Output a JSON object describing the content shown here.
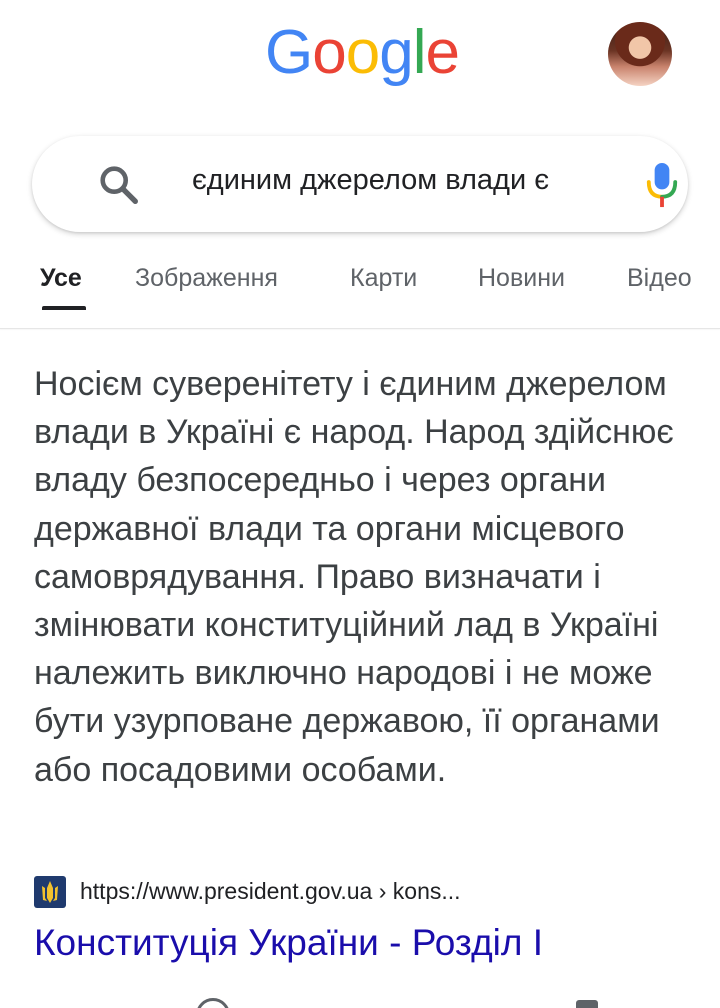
{
  "header": {
    "logo_letters": [
      {
        "char": "G",
        "color": "#4285F4"
      },
      {
        "char": "o",
        "color": "#EA4335"
      },
      {
        "char": "o",
        "color": "#FBBC05"
      },
      {
        "char": "g",
        "color": "#4285F4"
      },
      {
        "char": "l",
        "color": "#34A853"
      },
      {
        "char": "e",
        "color": "#EA4335"
      }
    ]
  },
  "search": {
    "query": "єдиним джерелом влади є"
  },
  "tabs": [
    {
      "label": "Усе",
      "active": true
    },
    {
      "label": "Зображення",
      "active": false
    },
    {
      "label": "Карти",
      "active": false
    },
    {
      "label": "Новини",
      "active": false
    },
    {
      "label": "Відео",
      "active": false
    }
  ],
  "snippet": {
    "text": "Носієм суверенітету і єдиним джерелом влади в Україні є народ. Народ здійснює владу безпосередньо і через органи державної влади та органи місцевого самоврядування. Право визначати і змінювати конституційний лад в Україні належить виключно народові і не може бути узурповане державою, її органами або посадовими особами."
  },
  "result": {
    "url": "https://www.president.gov.ua › kons...",
    "title": "Конституція України - Розділ I"
  },
  "colors": {
    "link": "#1a0dab",
    "text": "#3c4043",
    "tab_inactive": "#5f6368"
  }
}
